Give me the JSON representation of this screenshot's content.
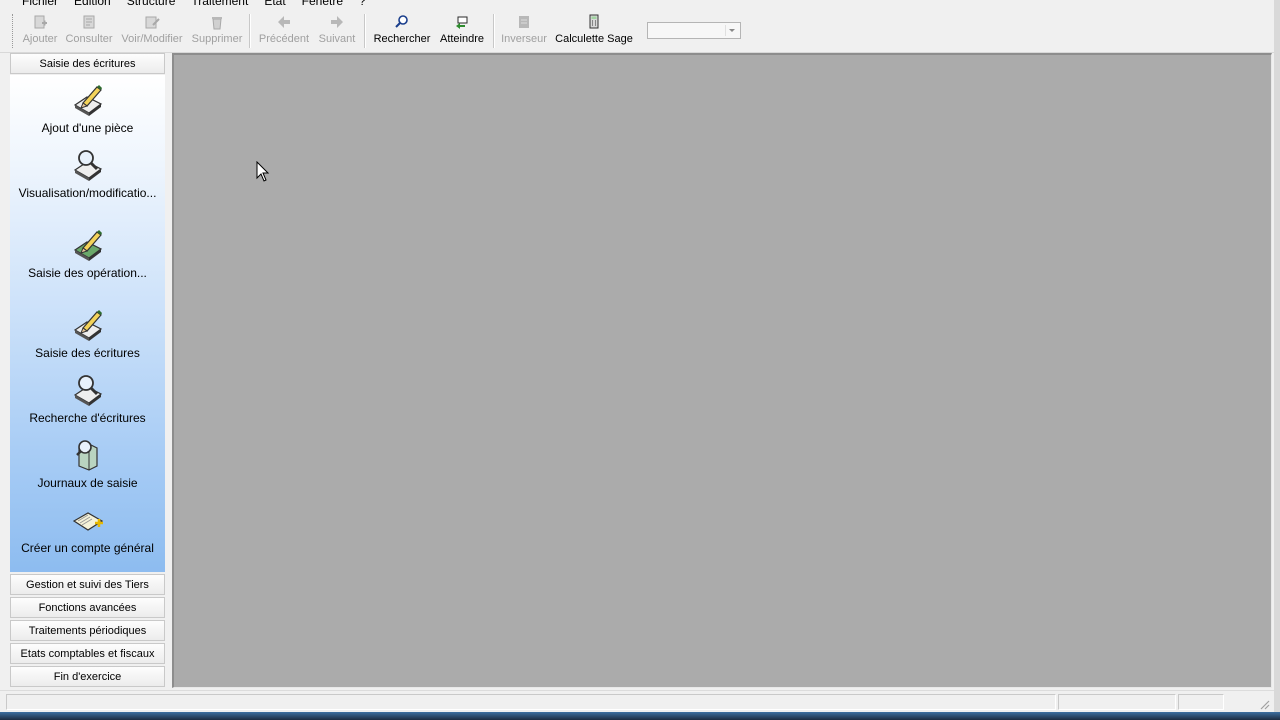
{
  "menu": {
    "items": [
      "Fichier",
      "Edition",
      "Structure",
      "Traitement",
      "Etat",
      "Fenêtre",
      "?"
    ]
  },
  "toolbar": {
    "buttons": [
      {
        "label": "Ajouter",
        "icon": "add-icon",
        "enabled": false
      },
      {
        "label": "Consulter",
        "icon": "consult-icon",
        "enabled": false
      },
      {
        "label": "Voir/Modifier",
        "icon": "edit-icon",
        "enabled": false
      },
      {
        "label": "Supprimer",
        "icon": "trash-icon",
        "enabled": false
      },
      {
        "label": "Précédent",
        "icon": "arrow-left-icon",
        "enabled": false
      },
      {
        "label": "Suivant",
        "icon": "arrow-right-icon",
        "enabled": false
      },
      {
        "label": "Rechercher",
        "icon": "magnifier-icon",
        "enabled": true
      },
      {
        "label": "Atteindre",
        "icon": "goto-icon",
        "enabled": true
      },
      {
        "label": "Inverseur",
        "icon": "inverter-icon",
        "enabled": false
      },
      {
        "label": "Calculette Sage",
        "icon": "calculator-icon",
        "enabled": true
      }
    ],
    "combo_value": ""
  },
  "navbar": {
    "active_group": "Saisie des écritures",
    "items": [
      {
        "label": "Ajout d'une pièce",
        "icon": "pencil-document-icon"
      },
      {
        "label": "Visualisation/modificatio...",
        "icon": "magnifier-document-icon"
      },
      {
        "label": "Saisie des opération...",
        "icon": "pencil-document-icon"
      },
      {
        "label": "Saisie des écritures",
        "icon": "pencil-document-icon"
      },
      {
        "label": "Recherche d'écritures",
        "icon": "magnifier-document-icon"
      },
      {
        "label": "Journaux de saisie",
        "icon": "journal-icon"
      },
      {
        "label": "Créer un compte général",
        "icon": "new-account-icon"
      }
    ],
    "groups": [
      "Gestion et suivi des Tiers",
      "Fonctions avancées",
      "Traitements périodiques",
      "Etats comptables et fiscaux",
      "Fin d'exercice"
    ]
  },
  "colors": {
    "mdi_background": "#ababab",
    "nav_gradient_bottom": "#8dbcf0",
    "disabled_text": "#a0a0a0"
  }
}
